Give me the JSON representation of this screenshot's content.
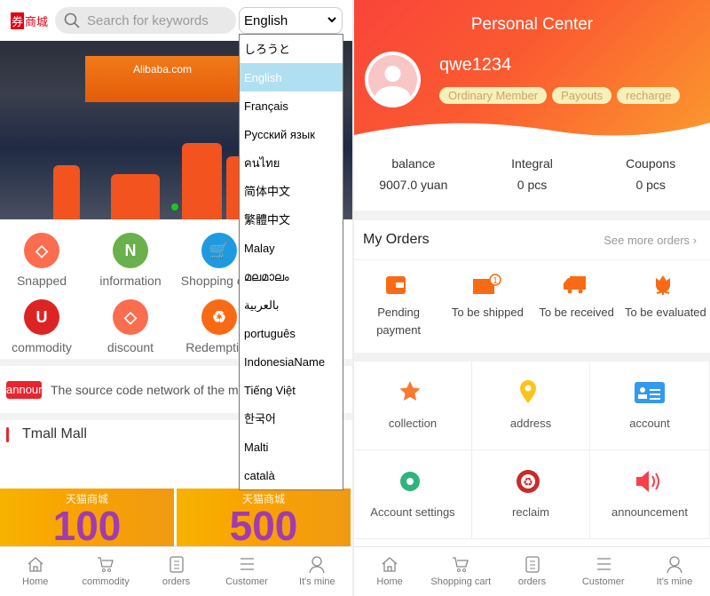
{
  "left": {
    "logo": {
      "mark": "券",
      "text": "商城"
    },
    "search": {
      "placeholder": "Search for keywords",
      "icon": "search-icon"
    },
    "language_select": {
      "value": "English",
      "options": [
        "しろうと",
        "English",
        "Français",
        "Русский язык",
        "คนไทย",
        "简体中文",
        "繁體中文",
        "Malay",
        "മലമാലം",
        "بالعربية",
        "português",
        "IndonesiaName",
        "Tiếng Việt",
        "한국어",
        "Malti",
        "català"
      ],
      "highlighted": "English"
    },
    "banner": {
      "sign_text": "Alibaba.com"
    },
    "shortcuts": [
      {
        "label": "Snapped",
        "icon": "tag-icon",
        "color": "#fa6e4f"
      },
      {
        "label": "information",
        "icon": "note-icon",
        "color": "#6ab04c"
      },
      {
        "label": "Shopping cart",
        "icon": "cart-icon",
        "color": "#1e9be0"
      },
      {
        "label": "commodity",
        "icon": "bag-icon",
        "color": "#dd2424"
      },
      {
        "label": "discount",
        "icon": "tag-icon",
        "color": "#fa6e4f"
      },
      {
        "label": "Redemption",
        "icon": "recycle-icon",
        "color": "#fa6a14"
      }
    ],
    "announcement": {
      "tag": "announcement",
      "text": "The source code network of the mall"
    },
    "section_title": "Tmall Mall",
    "promo": [
      {
        "title": "天猫商城",
        "amount": "100"
      },
      {
        "title": "天猫商城",
        "amount": "500"
      }
    ],
    "nav": [
      "Home",
      "commodity",
      "orders",
      "Customer",
      "It's mine"
    ]
  },
  "right": {
    "title": "Personal Center",
    "username": "qwe1234",
    "badges": [
      "Ordinary Member",
      "Payouts",
      "recharge"
    ],
    "stats": [
      {
        "label": "balance",
        "value": "9007.0 yuan"
      },
      {
        "label": "Integral",
        "value": "0 pcs"
      },
      {
        "label": "Coupons",
        "value": "0 pcs"
      }
    ],
    "orders": {
      "title": "My Orders",
      "more": "See more orders",
      "items": [
        {
          "label": "Pending payment",
          "icon": "wallet-icon"
        },
        {
          "label": "To be shipped",
          "icon": "package-icon",
          "badge": "1"
        },
        {
          "label": "To be received",
          "icon": "truck-icon"
        },
        {
          "label": "To be evaluated",
          "icon": "flower-icon"
        }
      ]
    },
    "grid": [
      {
        "label": "collection",
        "icon": "star-icon",
        "color": "#fa7a30"
      },
      {
        "label": "address",
        "icon": "location-pin-icon",
        "color": "#fcc419"
      },
      {
        "label": "account",
        "icon": "id-card-icon",
        "color": "#339af0"
      },
      {
        "label": "Account settings",
        "icon": "gear-icon",
        "color": "#2fb47c"
      },
      {
        "label": "reclaim",
        "icon": "recycle-icon",
        "color": "#c92a2a"
      },
      {
        "label": "announcement",
        "icon": "speaker-icon",
        "color": "#fa3e4a"
      }
    ],
    "nav": [
      "Home",
      "Shopping cart",
      "orders",
      "Customer",
      "It's mine"
    ]
  }
}
